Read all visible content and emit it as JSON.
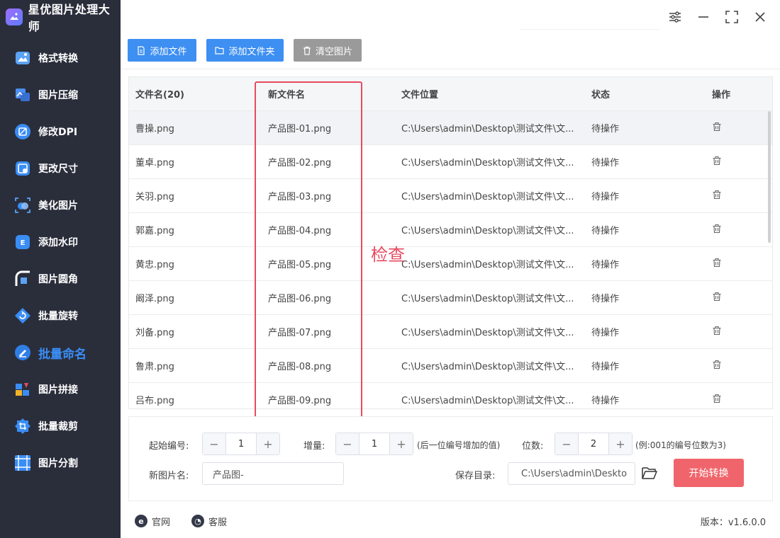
{
  "app": {
    "title": "星优图片处理大师"
  },
  "sidebar": {
    "items": [
      {
        "label": "格式转换",
        "icon": "format-convert-icon"
      },
      {
        "label": "图片压缩",
        "icon": "compress-icon"
      },
      {
        "label": "修改DPI",
        "icon": "dpi-icon"
      },
      {
        "label": "更改尺寸",
        "icon": "resize-icon"
      },
      {
        "label": "美化图片",
        "icon": "beautify-icon"
      },
      {
        "label": "添加水印",
        "icon": "watermark-icon"
      },
      {
        "label": "图片圆角",
        "icon": "round-corner-icon"
      },
      {
        "label": "批量旋转",
        "icon": "rotate-icon"
      },
      {
        "label": "批量命名",
        "icon": "rename-icon",
        "active": true
      },
      {
        "label": "图片拼接",
        "icon": "stitch-icon"
      },
      {
        "label": "批量裁剪",
        "icon": "crop-icon"
      },
      {
        "label": "图片分割",
        "icon": "split-icon"
      }
    ]
  },
  "toolbar": {
    "add_file": "添加文件",
    "add_folder": "添加文件夹",
    "clear": "清空图片"
  },
  "table": {
    "headers": {
      "filename": "文件名(20)",
      "newname": "新文件名",
      "location": "文件位置",
      "status": "状态",
      "action": "操作"
    },
    "rows": [
      {
        "filename": "曹操.png",
        "newname": "产品图-01.png",
        "location": "C:\\Users\\admin\\Desktop\\测试文件\\文...",
        "status": "待操作"
      },
      {
        "filename": "董卓.png",
        "newname": "产品图-02.png",
        "location": "C:\\Users\\admin\\Desktop\\测试文件\\文...",
        "status": "待操作"
      },
      {
        "filename": "关羽.png",
        "newname": "产品图-03.png",
        "location": "C:\\Users\\admin\\Desktop\\测试文件\\文...",
        "status": "待操作"
      },
      {
        "filename": "郭嘉.png",
        "newname": "产品图-04.png",
        "location": "C:\\Users\\admin\\Desktop\\测试文件\\文...",
        "status": "待操作"
      },
      {
        "filename": "黄忠.png",
        "newname": "产品图-05.png",
        "location": "C:\\Users\\admin\\Desktop\\测试文件\\文...",
        "status": "待操作"
      },
      {
        "filename": "阚泽.png",
        "newname": "产品图-06.png",
        "location": "C:\\Users\\admin\\Desktop\\测试文件\\文...",
        "status": "待操作"
      },
      {
        "filename": "刘备.png",
        "newname": "产品图-07.png",
        "location": "C:\\Users\\admin\\Desktop\\测试文件\\文...",
        "status": "待操作"
      },
      {
        "filename": "鲁肃.png",
        "newname": "产品图-08.png",
        "location": "C:\\Users\\admin\\Desktop\\测试文件\\文...",
        "status": "待操作"
      },
      {
        "filename": "吕布.png",
        "newname": "产品图-09.png",
        "location": "C:\\Users\\admin\\Desktop\\测试文件\\文...",
        "status": "待操作"
      }
    ]
  },
  "annotation": {
    "text": "检查",
    "color": "#e84a5f"
  },
  "settings": {
    "start_label": "起始编号:",
    "start_value": "1",
    "increment_label": "增量:",
    "increment_value": "1",
    "increment_hint": "(后一位编号增加的值)",
    "digits_label": "位数:",
    "digits_value": "2",
    "digits_hint": "(例:001的编号位数为3)",
    "newname_label": "新图片名:",
    "newname_value": "产品图-",
    "save_label": "保存目录:",
    "save_value": "C:\\Users\\admin\\Deskto",
    "start_button": "开始转换"
  },
  "footer": {
    "website": "官网",
    "support": "客服",
    "version": "版本：v1.6.0.0"
  },
  "colors": {
    "sidebar_bg": "#2a2e3b",
    "accent": "#3d8ff2",
    "start_button": "#f0656b",
    "highlight": "#e84a5f"
  }
}
